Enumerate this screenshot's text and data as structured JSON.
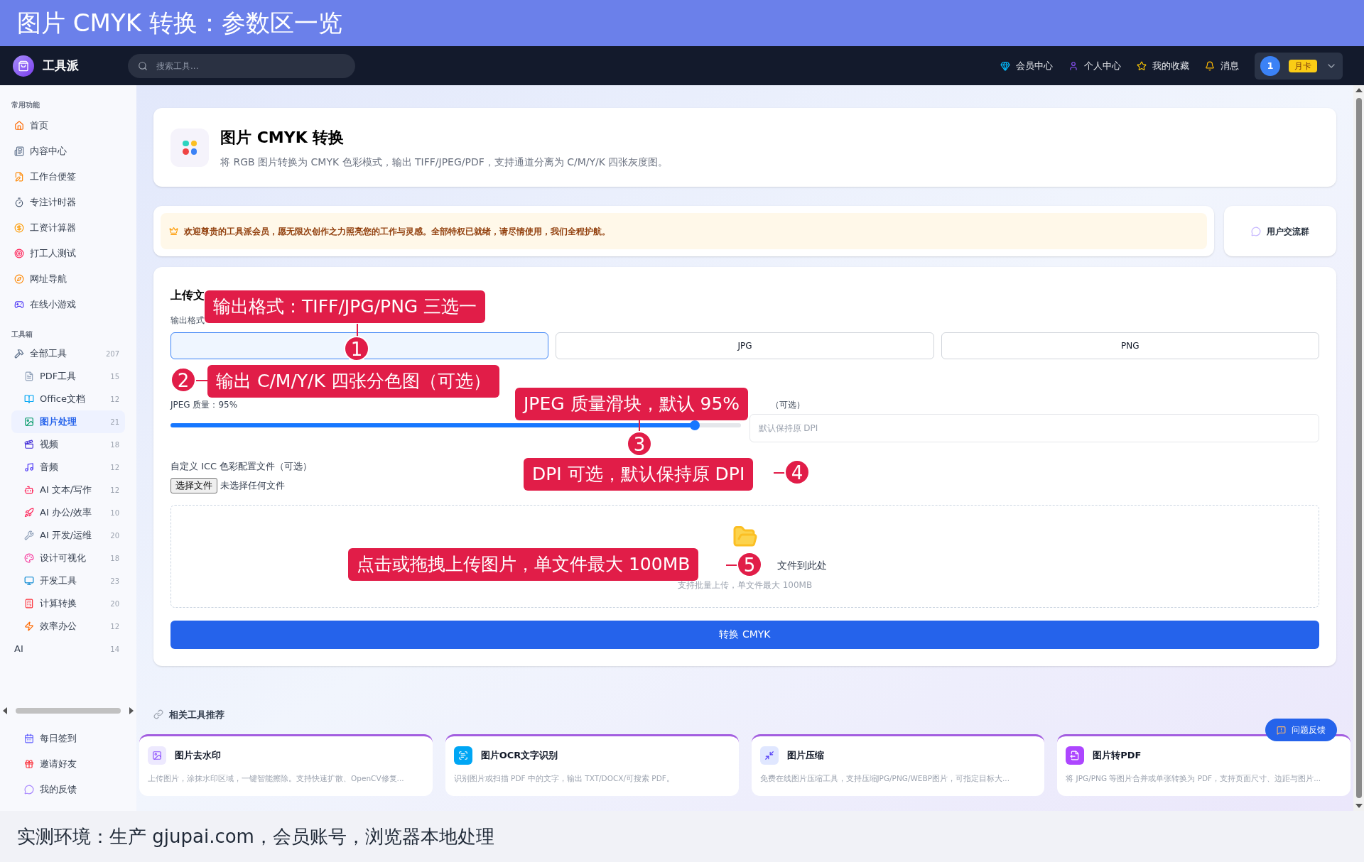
{
  "banner": {
    "title": "图片 CMYK 转换：参数区一览"
  },
  "header": {
    "brand": "工具派",
    "search": {
      "placeholder": "搜索工具..."
    },
    "nav": [
      {
        "label": "会员中心",
        "kind": "gem"
      },
      {
        "label": "个人中心",
        "kind": "user"
      },
      {
        "label": "我的收藏",
        "kind": "star"
      },
      {
        "label": "消息",
        "kind": "bell"
      }
    ],
    "user": {
      "avatar": "1",
      "badge": "月卡"
    }
  },
  "sidebar": {
    "sections": [
      {
        "title": "常用功能",
        "items": [
          {
            "label": "首页"
          },
          {
            "label": "内容中心"
          },
          {
            "label": "工作台便签"
          },
          {
            "label": "专注计时器"
          },
          {
            "label": "工资计算器"
          },
          {
            "label": "打工人测试"
          },
          {
            "label": "网址导航"
          },
          {
            "label": "在线小游戏"
          }
        ]
      },
      {
        "title": "工具箱",
        "items": [
          {
            "label": "全部工具",
            "count": "207",
            "selected": false,
            "children": [
              {
                "label": "PDF工具",
                "count": "15",
                "selected": false
              },
              {
                "label": "Office文档",
                "count": "12",
                "selected": false
              },
              {
                "label": "图片处理",
                "count": "21",
                "selected": true
              },
              {
                "label": "视频",
                "count": "18",
                "selected": false
              },
              {
                "label": "音频",
                "count": "12",
                "selected": false
              },
              {
                "label": "AI 文本/写作",
                "count": "12",
                "selected": false
              },
              {
                "label": "AI 办公/效率",
                "count": "10",
                "selected": false
              },
              {
                "label": "AI 开发/运维",
                "count": "20",
                "selected": false
              },
              {
                "label": "设计可视化",
                "count": "18",
                "selected": false
              },
              {
                "label": "开发工具",
                "count": "23",
                "selected": false
              },
              {
                "label": "计算转换",
                "count": "20",
                "selected": false
              },
              {
                "label": "效率办公",
                "count": "12",
                "selected": false
              }
            ]
          },
          {
            "label": "AI",
            "count": "14",
            "selected": false
          }
        ]
      }
    ],
    "footer": [
      {
        "label": "每日签到"
      },
      {
        "label": "邀请好友"
      },
      {
        "label": "我的反馈"
      }
    ]
  },
  "tool": {
    "title": "图片 CMYK 转换",
    "description": "将 RGB 图片转换为 CMYK 色彩模式，输出 TIFF/JPEG/PDF，支持通道分离为 C/M/Y/K 四张灰度图。"
  },
  "notice": {
    "text": "欢迎尊贵的工具派会员，愿无限次创作之力照亮您的工作与灵感。全部特权已就绪，请尽情使用，我们全程护航。",
    "group_button": "用户交流群"
  },
  "upload": {
    "title": "上传文",
    "format_label": "输出格式",
    "formats": [
      {
        "selected": true
      },
      {
        "label": "JPG",
        "selected": false
      },
      {
        "label": "PNG",
        "selected": false
      }
    ],
    "quality": {
      "label": "JPEG 质量：95%",
      "level": 0.92
    },
    "dpi": {
      "label": "（可选）",
      "placeholder": "默认保持原 DPI"
    },
    "icc": {
      "label": "自定义 ICC 色彩配置文件（可选）",
      "button": "选择文件",
      "status": "未选择任何文件"
    },
    "dropzone": {
      "text": "文件到此处",
      "hint": "支持批量上传，单文件最大 100MB"
    },
    "submit": "转换 CMYK"
  },
  "related": {
    "title": "相关工具推荐",
    "tools": [
      {
        "title": "图片去水印",
        "description": "上传图片，涂抹水印区域，一键智能擦除。支持快速扩散、OpenCV修复..."
      },
      {
        "title": "图片OCR文字识别",
        "description": "识别图片或扫描 PDF 中的文字，输出 TXT/DOCX/可搜索 PDF。"
      },
      {
        "title": "图片压缩",
        "description": "免费在线图片压缩工具，支持压缩JPG/PNG/WEBP图片，可指定目标大..."
      },
      {
        "title": "图片转PDF",
        "description": "将 JPG/PNG 等图片合并或单张转换为 PDF，支持页面尺寸、边距与图片..."
      }
    ]
  },
  "feedback_button": "问题反馈",
  "annotations": [
    {
      "number": "1",
      "text": "输出格式：TIFF/JPG/PNG 三选一"
    },
    {
      "number": "2",
      "text": "输出 C/M/Y/K 四张分色图（可选）"
    },
    {
      "number": "3",
      "text": "JPEG 质量滑块，默认 95%"
    },
    {
      "number": "4",
      "text": "DPI 可选，默认保持原 DPI"
    },
    {
      "number": "5",
      "text": "点击或拖拽上传图片，单文件最大 100MB"
    }
  ],
  "caption": "实测环境：生产 gjupai.com，会员账号，浏览器本地处理"
}
